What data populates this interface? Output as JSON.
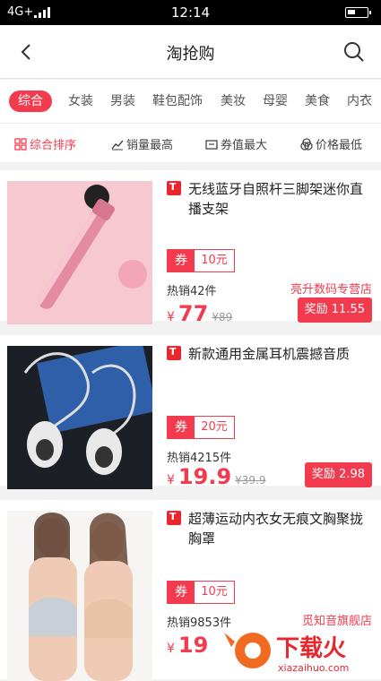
{
  "status": {
    "network": "4G+",
    "time": "12:14"
  },
  "header": {
    "title": "淘抢购",
    "back_icon": "chevron-left-icon",
    "search_icon": "search-icon"
  },
  "categories": [
    "综合",
    "女装",
    "男装",
    "鞋包配饰",
    "美妆",
    "母婴",
    "美食",
    "内衣"
  ],
  "sorts": [
    "综合排序",
    "销量最高",
    "券值最大",
    "价格最低"
  ],
  "products": [
    {
      "title": "无线蓝牙自照杆三脚架迷你直播支架",
      "coupon_label": "券",
      "coupon_value": "10元",
      "sold": "热销42件",
      "shop": "亮升数码专营店",
      "yen": "¥",
      "price": "77",
      "orig_price": "¥89",
      "reward": "奖励 11.55"
    },
    {
      "title": "新款通用金属耳机震撼音质",
      "coupon_label": "券",
      "coupon_value": "20元",
      "sold": "热销4215件",
      "shop": "",
      "yen": "¥",
      "price": "19.9",
      "orig_price": "¥39.9",
      "reward": "奖励 2.98"
    },
    {
      "title": "超薄运动内衣女无痕文胸聚拢胸罩",
      "coupon_label": "券",
      "coupon_value": "10元",
      "sold": "热销9853件",
      "shop": "觅知音旗舰店",
      "yen": "¥",
      "price": "19",
      "orig_price": "",
      "reward": ""
    }
  ],
  "watermark": {
    "text": "下载火",
    "domain": "xiazaihuo.com"
  },
  "colors": {
    "accent": "#f23b4e",
    "tmall": "#e8262e"
  }
}
